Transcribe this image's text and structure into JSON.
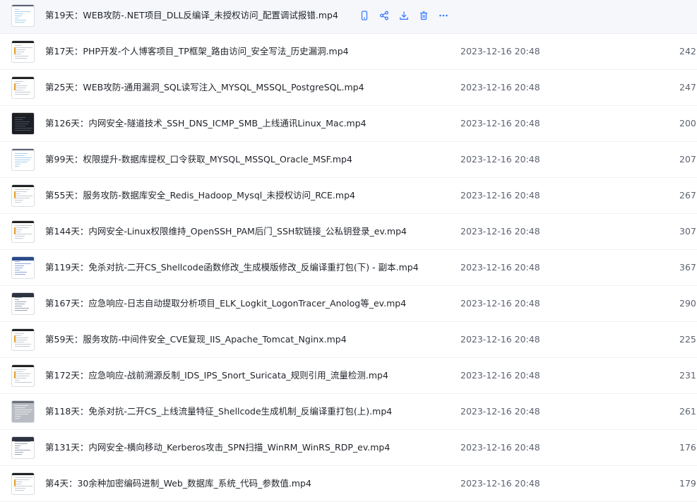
{
  "accent_color": "#3b7cff",
  "row_actions": [
    {
      "icon": "phone-icon"
    },
    {
      "icon": "share-icon"
    },
    {
      "icon": "download-icon"
    },
    {
      "icon": "delete-icon"
    },
    {
      "icon": "more-icon"
    }
  ],
  "files": [
    {
      "name": "第19天：WEB攻防-.NET项目_DLL反编译_未授权访问_配置调试报错.mp4",
      "date": "",
      "size": "",
      "thumb": "light",
      "hover": true
    },
    {
      "name": "第17天：PHP开发-个人博客项目_TP框架_路由访问_安全写法_历史漏洞.mp4",
      "date": "2023-12-16 20:48",
      "size": "242.",
      "thumb": "plain"
    },
    {
      "name": "第25天：WEB攻防-通用漏洞_SQL读写注入_MYSQL_MSSQL_PostgreSQL.mp4",
      "date": "2023-12-16 20:48",
      "size": "247.",
      "thumb": "plain"
    },
    {
      "name": "第126天：内网安全-隧道技术_SSH_DNS_ICMP_SMB_上线通讯Linux_Mac.mp4",
      "date": "2023-12-16 20:48",
      "size": "200.",
      "thumb": "dark"
    },
    {
      "name": "第99天：权限提升-数据库提权_口令获取_MYSQL_MSSQL_Oracle_MSF.mp4",
      "date": "2023-12-16 20:48",
      "size": "207.",
      "thumb": "light"
    },
    {
      "name": "第55天：服务攻防-数据库安全_Redis_Hadoop_Mysql_未授权访问_RCE.mp4",
      "date": "2023-12-16 20:48",
      "size": "267.",
      "thumb": "plain"
    },
    {
      "name": "第144天：内网安全-Linux权限维持_OpenSSH_PAM后门_SSH软链接_公私钥登录_ev.mp4",
      "date": "2023-12-16 20:48",
      "size": "307.",
      "thumb": "plain"
    },
    {
      "name": "第119天：免杀对抗-二开CS_Shellcode函数修改_生成模版修改_反编译重打包(下) - 副本.mp4",
      "date": "2023-12-16 20:48",
      "size": "367.",
      "thumb": "blue"
    },
    {
      "name": "第167天：应急响应-日志自动提取分析项目_ELK_Logkit_LogonTracer_Anolog等_ev.mp4",
      "date": "2023-12-16 20:48",
      "size": "290.",
      "thumb": "win"
    },
    {
      "name": "第59天：服务攻防-中间件安全_CVE复现_IIS_Apache_Tomcat_Nginx.mp4",
      "date": "2023-12-16 20:48",
      "size": "225.",
      "thumb": "plain"
    },
    {
      "name": "第172天：应急响应-战前溯源反制_IDS_IPS_Snort_Suricata_规则引用_流量检测.mp4",
      "date": "2023-12-16 20:48",
      "size": "231.",
      "thumb": "plain"
    },
    {
      "name": "第118天：免杀对抗-二开CS_上线流量特征_Shellcode生成机制_反编译重打包(上).mp4",
      "date": "2023-12-16 20:48",
      "size": "261.",
      "thumb": "grey"
    },
    {
      "name": "第131天：内网安全-横向移动_Kerberos攻击_SPN扫描_WinRM_WinRS_RDP_ev.mp4",
      "date": "2023-12-16 20:48",
      "size": "176.",
      "thumb": "win"
    },
    {
      "name": "第4天：30余种加密编码进制_Web_数据库_系统_代码_参数值.mp4",
      "date": "2023-12-16 20:48",
      "size": "179.",
      "thumb": "plain"
    }
  ]
}
